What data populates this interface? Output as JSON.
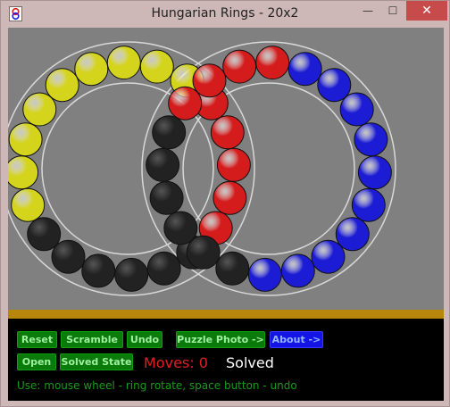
{
  "window": {
    "title": "Hungarian Rings - 20x2",
    "minimize_glyph": "—",
    "maximize_glyph": "☐",
    "close_glyph": "✕"
  },
  "buttons": {
    "reset": "Reset",
    "scramble": "Scramble",
    "undo": "Undo",
    "puzzle_photo": "Puzzle Photo ->",
    "about": "About ->",
    "open": "Open",
    "solved_state": "Solved State"
  },
  "status": {
    "moves_label": "Moves:",
    "moves_value": "0",
    "state": "Solved"
  },
  "hint": "Use: mouse wheel - ring rotate, space button - undo",
  "colors": {
    "yellow": "#d4d41c",
    "red": "#d41c1c",
    "black": "#222222",
    "blue": "#1c1cd4",
    "ring": "#d8d8d8"
  },
  "puzzle": {
    "left_ring": [
      "red",
      "red",
      "red",
      "red",
      "red",
      "black",
      "black",
      "black",
      "black",
      "black",
      "black",
      "yellow",
      "yellow",
      "yellow",
      "yellow",
      "yellow",
      "yellow",
      "yellow",
      "yellow",
      "yellow"
    ],
    "right_ring": [
      "red",
      "red",
      "red",
      "red",
      "blue",
      "blue",
      "blue",
      "blue",
      "blue",
      "blue",
      "blue",
      "blue",
      "blue",
      "blue",
      "black",
      "black",
      "black",
      "black",
      "black",
      "black"
    ]
  }
}
